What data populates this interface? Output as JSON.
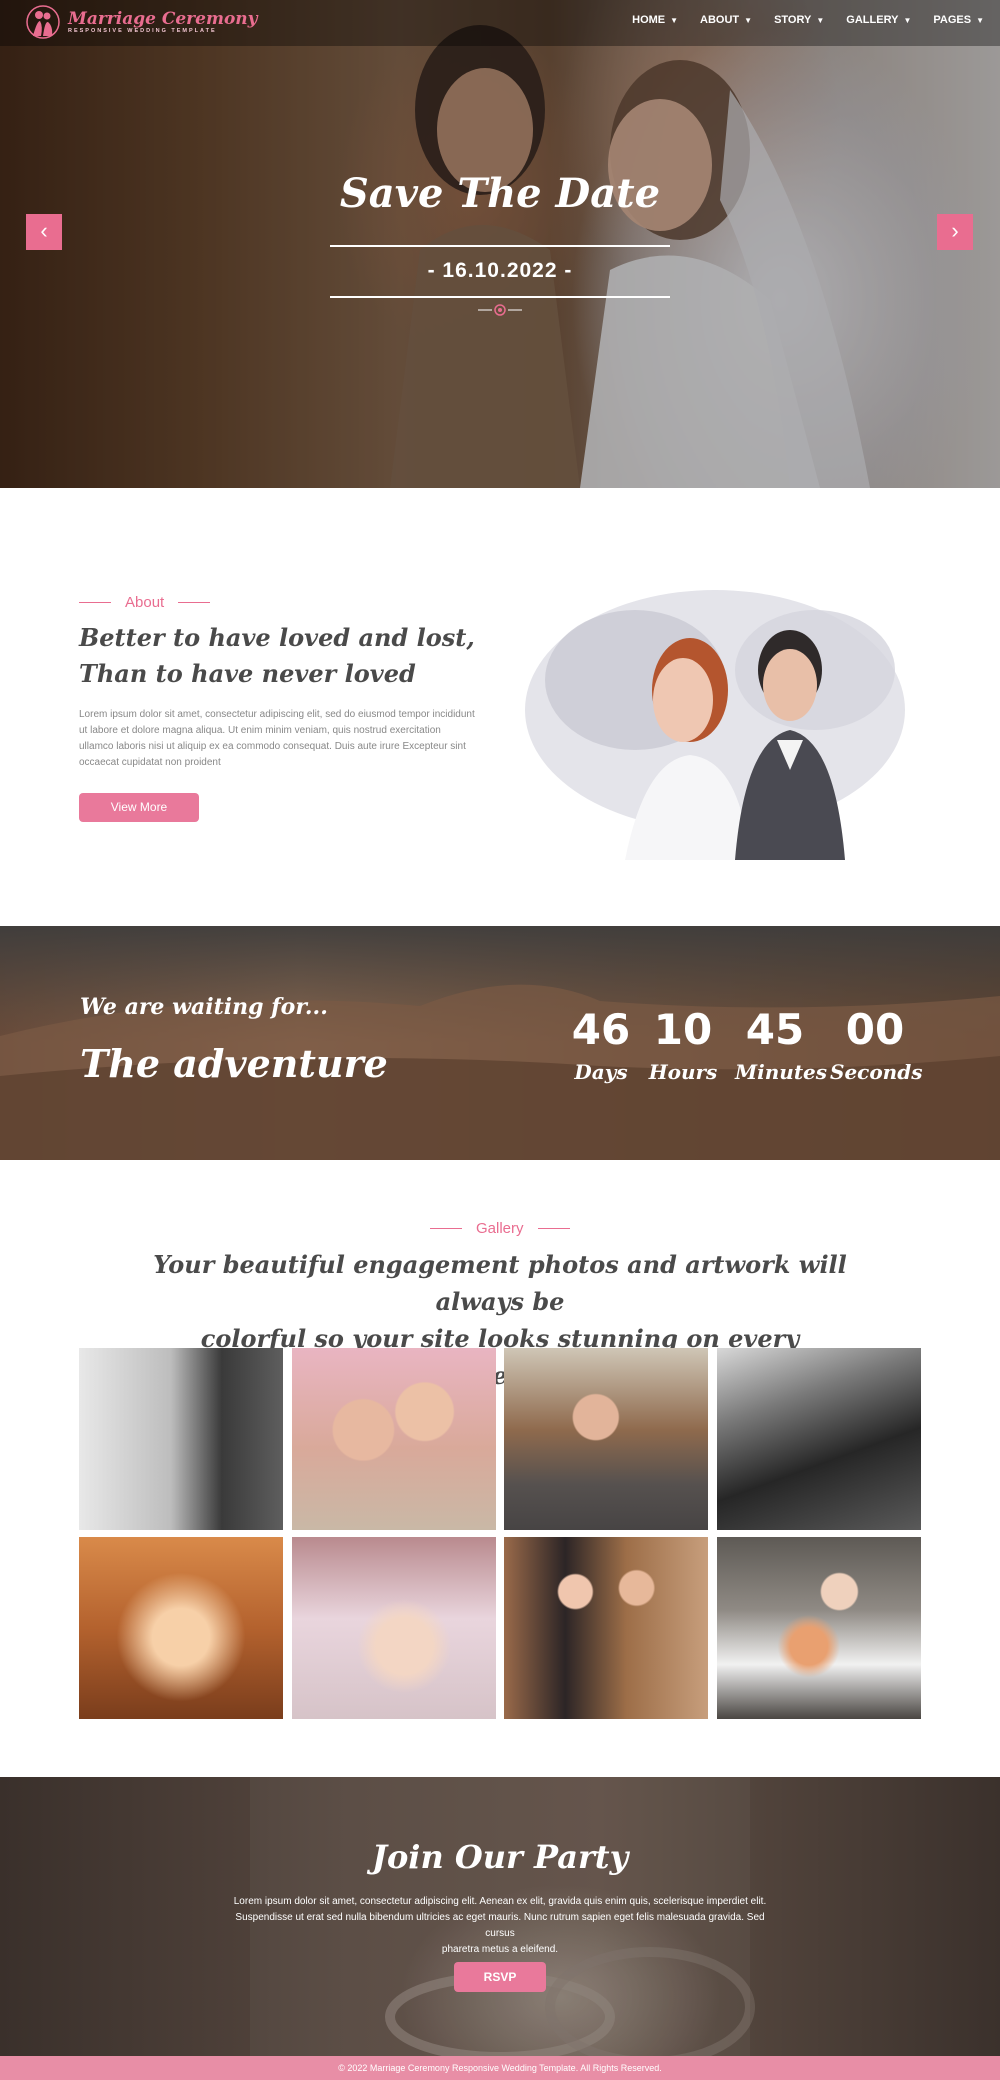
{
  "brand": {
    "title": "Marriage Ceremony",
    "subtitle": "RESPONSIVE WEDDING TEMPLATE",
    "accent_color": "#e96d90"
  },
  "nav": {
    "items": [
      {
        "label": "HOME",
        "icon": "chevron-down-icon"
      },
      {
        "label": "ABOUT",
        "icon": "chevron-down-icon"
      },
      {
        "label": "STORY",
        "icon": "chevron-down-icon"
      },
      {
        "label": "GALLERY",
        "icon": "chevron-down-icon"
      },
      {
        "label": "PAGES",
        "icon": "chevron-down-icon"
      }
    ]
  },
  "hero": {
    "title": "Save The Date",
    "date": "- 16.10.2022 -",
    "prev_icon": "chevron-left-icon",
    "next_icon": "chevron-right-icon",
    "ornament_icon": "heart-ornament-icon"
  },
  "about": {
    "label": "About",
    "heading_line1": "Better to have loved and lost,",
    "heading_line2": "Than to have never loved",
    "text": "Lorem ipsum dolor sit amet, consectetur adipiscing elit, sed do eiusmod tempor incididunt ut labore et dolore magna aliqua. Ut enim minim veniam, quis nostrud exercitation ullamco laboris nisi ut aliquip ex ea commodo consequat. Duis aute irure Excepteur sint occaecat cupidatat non proident",
    "button": "View More"
  },
  "countdown": {
    "waiting": "We are waiting for...",
    "headline": "The adventure",
    "units": [
      {
        "value": "46",
        "label": "Days"
      },
      {
        "value": "10",
        "label": "Hours"
      },
      {
        "value": "45",
        "label": "Minutes"
      },
      {
        "value": "00",
        "label": "Seconds"
      }
    ]
  },
  "gallery": {
    "label": "Gallery",
    "heading_line1": "Your beautiful engagement photos and artwork will always be",
    "heading_line2": "colorful so your site looks stunning on every screen."
  },
  "party": {
    "title": "Join Our Party",
    "text_line1": "Lorem ipsum dolor sit amet, consectetur adipiscing elit. Aenean ex elit, gravida quis enim quis, scelerisque imperdiet elit.",
    "text_line2": "Suspendisse ut erat sed nulla bibendum ultricies ac eget mauris. Nunc rutrum sapien eget felis malesuada gravida. Sed cursus",
    "text_line3": "pharetra metus a eleifend.",
    "button": "RSVP"
  },
  "footer": {
    "text": "© 2022 Marriage Ceremony Responsive Wedding Template. All Rights Reserved."
  }
}
